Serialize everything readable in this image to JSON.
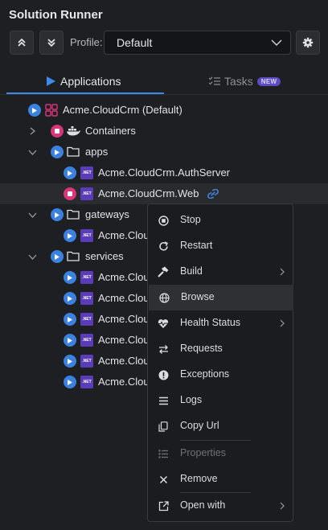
{
  "title": "Solution Runner",
  "toolbar": {
    "profile_label": "Profile:",
    "profile_value": "Default"
  },
  "tabs": {
    "applications": "Applications",
    "tasks": "Tasks",
    "tasks_badge": "NEW"
  },
  "tree": [
    {
      "label": "Acme.CloudCrm (Default)",
      "icon": "solution-icon",
      "state": "stopped"
    },
    {
      "label": "Containers",
      "icon": "docker-icon",
      "state": "running"
    },
    {
      "label": "apps",
      "icon": "folder-icon",
      "state": "stopped"
    },
    {
      "label": "Acme.CloudCrm.AuthServer",
      "icon": "dotnet-icon",
      "state": "stopped"
    },
    {
      "label": "Acme.CloudCrm.Web",
      "icon": "dotnet-icon",
      "state": "running"
    },
    {
      "label": "gateways",
      "icon": "folder-icon",
      "state": "stopped"
    },
    {
      "label": "Acme.Clou",
      "icon": "dotnet-icon",
      "state": "stopped"
    },
    {
      "label": "services",
      "icon": "folder-icon",
      "state": "stopped"
    },
    {
      "label": "Acme.Clou",
      "icon": "dotnet-icon",
      "state": "stopped"
    },
    {
      "label": "Acme.Clou",
      "icon": "dotnet-icon",
      "state": "stopped"
    },
    {
      "label": "Acme.Clou",
      "icon": "dotnet-icon",
      "state": "stopped"
    },
    {
      "label": "Acme.Clou",
      "icon": "dotnet-icon",
      "state": "stopped"
    },
    {
      "label": "Acme.Clou",
      "icon": "dotnet-icon",
      "state": "stopped"
    },
    {
      "label": "Acme.Clou",
      "icon": "dotnet-icon",
      "state": "stopped"
    }
  ],
  "net_text": ".NET",
  "context_menu": [
    {
      "label": "Stop",
      "icon": "stop-icon"
    },
    {
      "label": "Restart",
      "icon": "restart-icon"
    },
    {
      "label": "Build",
      "icon": "hammer-icon",
      "submenu": true
    },
    {
      "label": "Browse",
      "icon": "globe-icon",
      "hovered": true
    },
    {
      "label": "Health Status",
      "icon": "heartbeat-icon",
      "submenu": true
    },
    {
      "label": "Requests",
      "icon": "swap-icon"
    },
    {
      "label": "Exceptions",
      "icon": "exclamation-icon"
    },
    {
      "label": "Logs",
      "icon": "lines-icon"
    },
    {
      "label": "Copy Url",
      "icon": "copy-icon"
    },
    {
      "label": "Properties",
      "icon": "list-icon",
      "disabled": true
    },
    {
      "label": "Remove",
      "icon": "x-icon"
    },
    {
      "label": "Open with",
      "icon": "external-link-icon",
      "submenu": true
    }
  ],
  "colors": {
    "background": "#1e1f22",
    "accent": "#3f8ae8",
    "running": "#d8357a",
    "dotnet": "#5a3cb8",
    "badge": "#5b4cc4"
  }
}
